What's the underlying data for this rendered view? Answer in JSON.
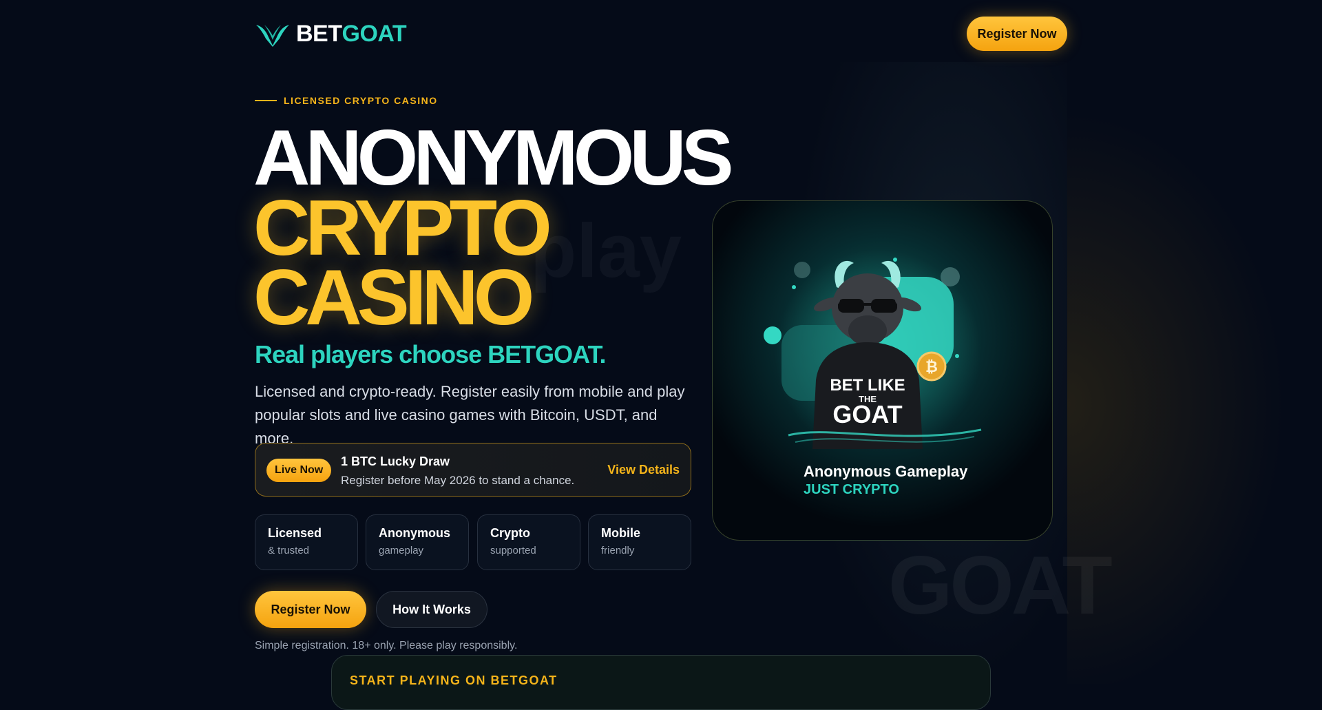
{
  "header": {
    "logo_bet": "BET",
    "logo_goat": "GOAT",
    "register_label": "Register Now"
  },
  "hero": {
    "eyebrow": "LICENSED CRYPTO CASINO",
    "headline_1": "ANONYMOUS",
    "headline_2": "CRYPTO",
    "headline_3": "CASINO",
    "tagline": "Real players choose BETGOAT.",
    "description": "Licensed and crypto-ready. Register easily from mobile and play popular slots and live casino games with Bitcoin, USDT, and more."
  },
  "promo": {
    "badge": "Live Now",
    "title": "1 BTC Lucky Draw",
    "subtitle": "Register before May 2026 to stand a chance.",
    "link": "View Details"
  },
  "features": [
    {
      "title": "Licensed",
      "subtitle": "& trusted"
    },
    {
      "title": "Anonymous",
      "subtitle": "gameplay"
    },
    {
      "title": "Crypto",
      "subtitle": "supported"
    },
    {
      "title": "Mobile",
      "subtitle": "friendly"
    }
  ],
  "cta": {
    "register_label": "Register Now",
    "how_label": "How It Works",
    "note": "Simple registration. 18+ only. Please play responsibly."
  },
  "card": {
    "title": "Anonymous Gameplay",
    "subtitle": "JUST CRYPTO",
    "art_icon": "goat-mascot-icon",
    "shirt_text_1": "BET LIKE",
    "shirt_text_2": "THE",
    "shirt_text_3": "GOAT"
  },
  "bottom": {
    "title": "START PLAYING ON BETGOAT"
  },
  "colors": {
    "accent_gold": "#fcc42c",
    "accent_teal": "#2dd4bf",
    "background": "#050b18"
  }
}
